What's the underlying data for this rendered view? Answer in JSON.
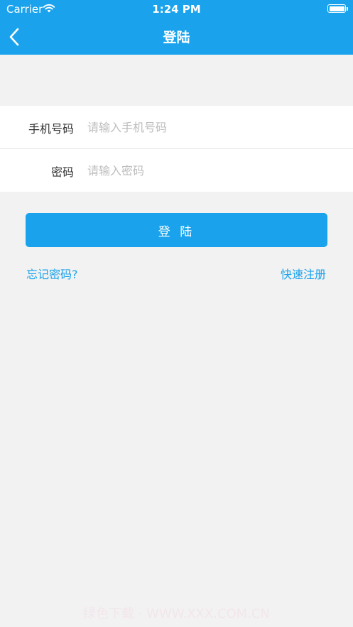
{
  "status_bar": {
    "carrier": "Carrier",
    "time": "1:24 PM",
    "wifi_icon": "wifi-icon",
    "battery_icon": "battery-icon"
  },
  "nav": {
    "title": "登陆",
    "back_icon": "chevron-left-icon"
  },
  "form": {
    "phone": {
      "label": "手机号码",
      "placeholder": "请输入手机号码",
      "value": ""
    },
    "password": {
      "label": "密码",
      "placeholder": "请输入密码",
      "value": ""
    }
  },
  "actions": {
    "login_label": "登 陆",
    "forgot_password": "忘记密码?",
    "quick_register": "快速注册"
  },
  "watermark": "绿色下载 · WWW.XXX.COM.CN",
  "colors": {
    "accent": "#1aa3ec",
    "background": "#f2f2f2",
    "card": "#ffffff",
    "label_text": "#333333",
    "placeholder_text": "#bdbdbd"
  }
}
